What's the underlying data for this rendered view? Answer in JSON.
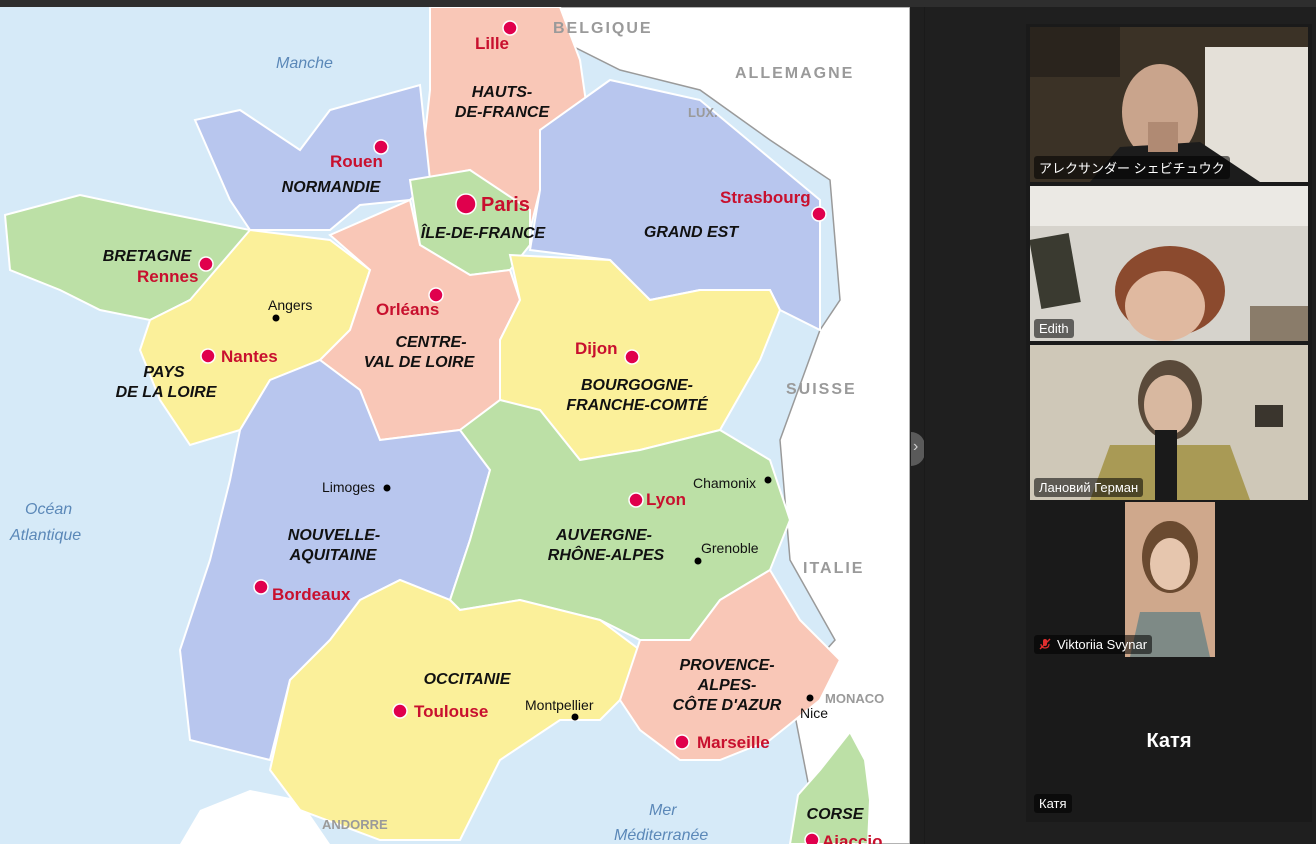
{
  "map": {
    "countries": {
      "belgique": "BELGIQUE",
      "allemagne": "ALLEMAGNE",
      "lux": "LUX.",
      "suisse": "SUISSE",
      "italie": "ITALIE",
      "monaco": "MONACO",
      "andorre": "ANDORRE"
    },
    "seas": {
      "manche": "Manche",
      "ocean_1": "Océan",
      "ocean_2": "Atlantique",
      "mer_1": "Mer",
      "mer_2": "Méditerranée"
    },
    "regions": {
      "hauts_1": "HAUTS-",
      "hauts_2": "DE-FRANCE",
      "normandie": "NORMANDIE",
      "idf": "ÎLE-DE-FRANCE",
      "grand_est": "GRAND EST",
      "bretagne": "BRETAGNE",
      "pays_1": "PAYS",
      "pays_2": "DE LA LOIRE",
      "centre_1": "CENTRE-",
      "centre_2": "VAL DE LOIRE",
      "bourgogne_1": "BOURGOGNE-",
      "bourgogne_2": "FRANCHE-COMTÉ",
      "nouvelle_1": "NOUVELLE-",
      "nouvelle_2": "AQUITAINE",
      "auvergne_1": "AUVERGNE-",
      "auvergne_2": "RHÔNE-ALPES",
      "occitanie": "OCCITANIE",
      "provence_1": "PROVENCE-",
      "provence_2": "ALPES-",
      "provence_3": "CÔTE D'AZUR",
      "corse": "CORSE"
    },
    "capitals": {
      "lille": "Lille",
      "rouen": "Rouen",
      "paris": "Paris",
      "strasbourg": "Strasbourg",
      "rennes": "Rennes",
      "orleans": "Orléans",
      "nantes": "Nantes",
      "dijon": "Dijon",
      "lyon": "Lyon",
      "bordeaux": "Bordeaux",
      "toulouse": "Toulouse",
      "marseille": "Marseille",
      "ajaccio": "Ajaccio"
    },
    "cities": {
      "angers": "Angers",
      "limoges": "Limoges",
      "chamonix": "Chamonix",
      "grenoble": "Grenoble",
      "montpellier": "Montpellier",
      "nice": "Nice"
    },
    "colors": {
      "sea": "#d6eaf8",
      "land": "#ffffff",
      "blue": "#b8c6ee",
      "pink": "#f9c7b7",
      "green": "#bce0a6",
      "yellow": "#fbf09a",
      "capital": "#c8102e"
    }
  },
  "participants": [
    {
      "name": "アレクサンダー シェビチュウク",
      "muted": false,
      "active": false
    },
    {
      "name": "Edith",
      "muted": false,
      "active": true
    },
    {
      "name": "Лановий Герман",
      "muted": false,
      "active": false
    },
    {
      "name": "Viktoriia Svynar",
      "muted": true,
      "active": false
    },
    {
      "name": "Катя",
      "display_name": "Катя",
      "muted": false,
      "active": false
    }
  ],
  "colors": {
    "active_speaker_border": "#2ecf6e",
    "muted_icon": "#e02f2f"
  }
}
